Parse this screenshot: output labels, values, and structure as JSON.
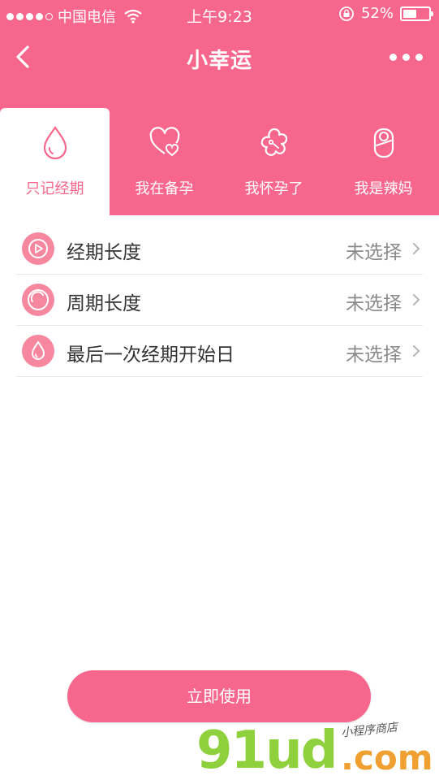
{
  "status_bar": {
    "carrier": "中国电信",
    "time": "上午9:23",
    "battery_percent_text": "52%",
    "battery_level": 0.52
  },
  "nav": {
    "title": "小幸运"
  },
  "tabs": [
    {
      "label": "只记经期",
      "icon": "drop-icon",
      "active": true
    },
    {
      "label": "我在备孕",
      "icon": "hearts-icon",
      "active": false
    },
    {
      "label": "我怀孕了",
      "icon": "flower-icon",
      "active": false
    },
    {
      "label": "我是辣妈",
      "icon": "baby-icon",
      "active": false
    }
  ],
  "rows": [
    {
      "label": "经期长度",
      "value": "未选择",
      "icon": "play-circle-icon"
    },
    {
      "label": "周期长度",
      "value": "未选择",
      "icon": "cycle-icon"
    },
    {
      "label": "最后一次经期开始日",
      "value": "未选择",
      "icon": "drop-icon"
    }
  ],
  "button": {
    "label": "立即使用"
  },
  "watermark": {
    "main": "91ud",
    "domain": ".com",
    "tagline": "小程序商店"
  },
  "colors": {
    "brand": "#f7668c",
    "icon_bg": "#f7879f",
    "value_gray": "#8a8a8a"
  }
}
